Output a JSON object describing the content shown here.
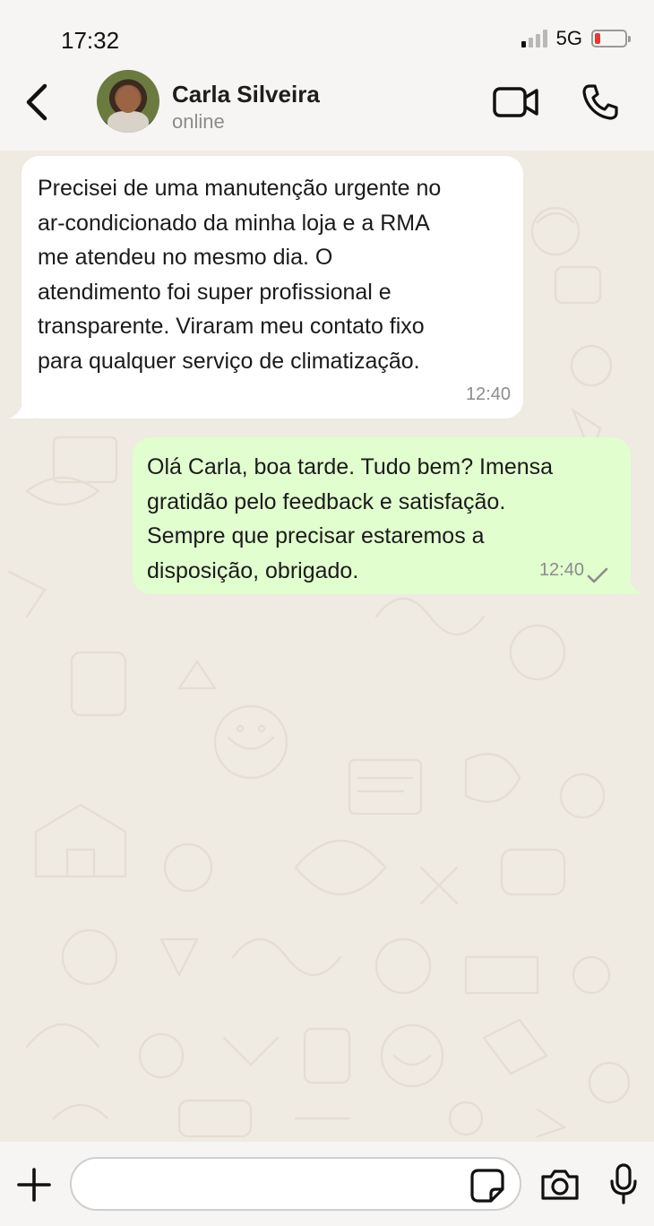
{
  "status_bar": {
    "time": "17:32",
    "network": "5G",
    "battery_level": 0.15,
    "signal_bars": 1
  },
  "header": {
    "contact_name": "Carla Silveira",
    "contact_status": "online",
    "icons": [
      "back-arrow-icon",
      "video-call-icon",
      "phone-call-icon"
    ]
  },
  "messages": [
    {
      "direction": "incoming",
      "text": "Precisei de uma manutenção urgente no\nar-condicionado da minha loja e a RMA\nme atendeu no mesmo dia. O\natendimento foi super profissional e\ntransparente. Viraram meu contato fixo\npara qualquer serviço de climatização.",
      "time": "12:40"
    },
    {
      "direction": "outgoing",
      "text": "Olá Carla, boa tarde. Tudo bem? Imensa\ngratidão pelo feedback e satisfação.\nSempre que precisar estaremos a\ndisposição, obrigado.",
      "time": "12:40",
      "status": "sent"
    }
  ],
  "composer": {
    "value": "",
    "placeholder": "",
    "icons": [
      "plus-icon",
      "sticker-icon",
      "camera-icon",
      "microphone-icon"
    ]
  },
  "colors": {
    "chat_background": "#efeae2",
    "incoming_bubble": "#ffffff",
    "outgoing_bubble": "#e1fecf",
    "bar_background": "#f6f5f3",
    "battery_low": "#e53935"
  }
}
